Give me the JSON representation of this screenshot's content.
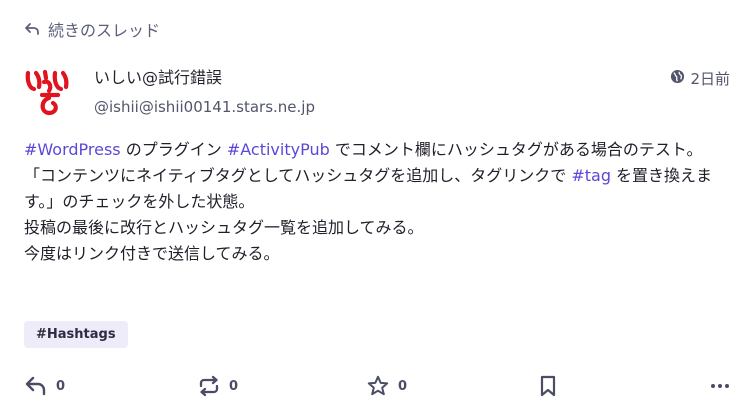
{
  "thread": {
    "label": "続きのスレッド"
  },
  "author": {
    "display_name": "いしい@試行錯誤",
    "acct": "@ishii@ishii00141.stars.ne.jp"
  },
  "meta": {
    "time": "2日前",
    "visibility_icon": "globe-icon"
  },
  "content": {
    "p1": {
      "tag1": "#WordPress",
      "t1": " のプラグイン ",
      "tag2": "#ActivityPub",
      "t2": " でコメント欄にハッシュタグがある場合のテスト。"
    },
    "p2": {
      "t1": "「コンテンツにネイティブタグとしてハッシュタグを追加し、タグリンクで ",
      "tag": "#tag",
      "t2": " を置き換えます。」のチェックを外した状態。"
    },
    "p3": "投稿の最後に改行とハッシュタグ一覧を追加してみる。",
    "p4": "今度はリンク付きで送信してみる。"
  },
  "hashtags": [
    "#Hashtags"
  ],
  "actions": {
    "reply_count": "0",
    "boost_count": "0",
    "favourite_count": "0"
  },
  "colors": {
    "link": "#5a48d8",
    "avatar_red": "#e0141e",
    "chip_bg": "#eeecf8"
  }
}
